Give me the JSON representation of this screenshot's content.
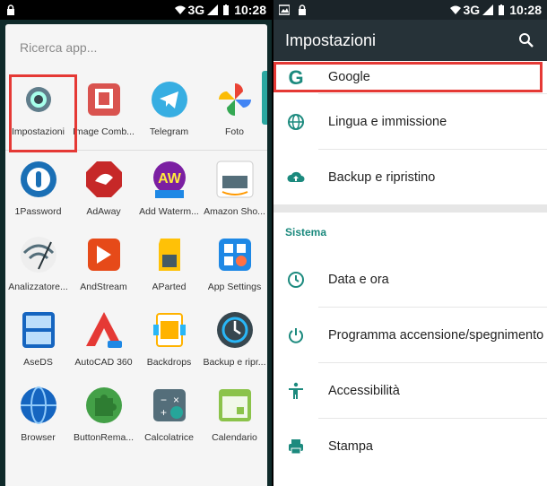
{
  "left_status": {
    "time": "10:28",
    "network": "3G"
  },
  "right_status": {
    "time": "10:28",
    "network": "3G"
  },
  "drawer": {
    "search_placeholder": "Ricerca app...",
    "rows": [
      [
        {
          "label": "Impostazioni",
          "icon": "settings-gear-icon",
          "color": "#607d8b"
        },
        {
          "label": "Image Comb...",
          "icon": "image-combiner-icon",
          "color": "#d9534f"
        },
        {
          "label": "Telegram",
          "icon": "telegram-icon",
          "color": "#37aee2"
        },
        {
          "label": "Foto",
          "icon": "photos-pinwheel-icon",
          "color": "#f4b400"
        }
      ],
      [
        {
          "label": "1Password",
          "icon": "1password-icon",
          "color": "#1a6fb5"
        },
        {
          "label": "AdAway",
          "icon": "adaway-icon",
          "color": "#c62828"
        },
        {
          "label": "Add Waterm...",
          "icon": "add-watermark-icon",
          "color": "#7b1fa2"
        },
        {
          "label": "Amazon Sho...",
          "icon": "amazon-icon",
          "color": "#ffffff"
        }
      ],
      [
        {
          "label": "Analizzatore...",
          "icon": "wifi-analyzer-icon",
          "color": "#eeeeee"
        },
        {
          "label": "AndStream",
          "icon": "andstream-icon",
          "color": "#e64a19"
        },
        {
          "label": "AParted",
          "icon": "sd-card-icon",
          "color": "#ffc107"
        },
        {
          "label": "App Settings",
          "icon": "app-settings-icon",
          "color": "#1e88e5"
        }
      ],
      [
        {
          "label": "AseDS",
          "icon": "aseds-icon",
          "color": "#1565c0"
        },
        {
          "label": "AutoCAD 360",
          "icon": "autocad-icon",
          "color": "#e53935"
        },
        {
          "label": "Backdrops",
          "icon": "backdrops-icon",
          "color": "#ffb300"
        },
        {
          "label": "Backup e ripr...",
          "icon": "backup-restore-icon",
          "color": "#37474f"
        }
      ],
      [
        {
          "label": "Browser",
          "icon": "browser-globe-icon",
          "color": "#1565c0"
        },
        {
          "label": "ButtonRema...",
          "icon": "puzzle-icon",
          "color": "#43a047"
        },
        {
          "label": "Calcolatrice",
          "icon": "calculator-icon",
          "color": "#546e7a"
        },
        {
          "label": "Calendario",
          "icon": "calendar-icon",
          "color": "#8bc34a"
        }
      ]
    ]
  },
  "settings": {
    "title": "Impostazioni",
    "items_top": [
      {
        "label": "Google",
        "icon": "google-g-icon"
      },
      {
        "label": "Lingua e immissione",
        "icon": "globe-icon"
      },
      {
        "label": "Backup e ripristino",
        "icon": "cloud-upload-icon"
      }
    ],
    "section": "Sistema",
    "items_system": [
      {
        "label": "Data e ora",
        "icon": "clock-icon"
      },
      {
        "label": "Programma accensione/spegnimento",
        "icon": "power-schedule-icon"
      },
      {
        "label": "Accessibilità",
        "icon": "accessibility-icon"
      },
      {
        "label": "Stampa",
        "icon": "printer-icon"
      }
    ]
  },
  "colors": {
    "highlight": "#e53935",
    "accent": "#1c8a7e",
    "appbar": "#263238"
  }
}
